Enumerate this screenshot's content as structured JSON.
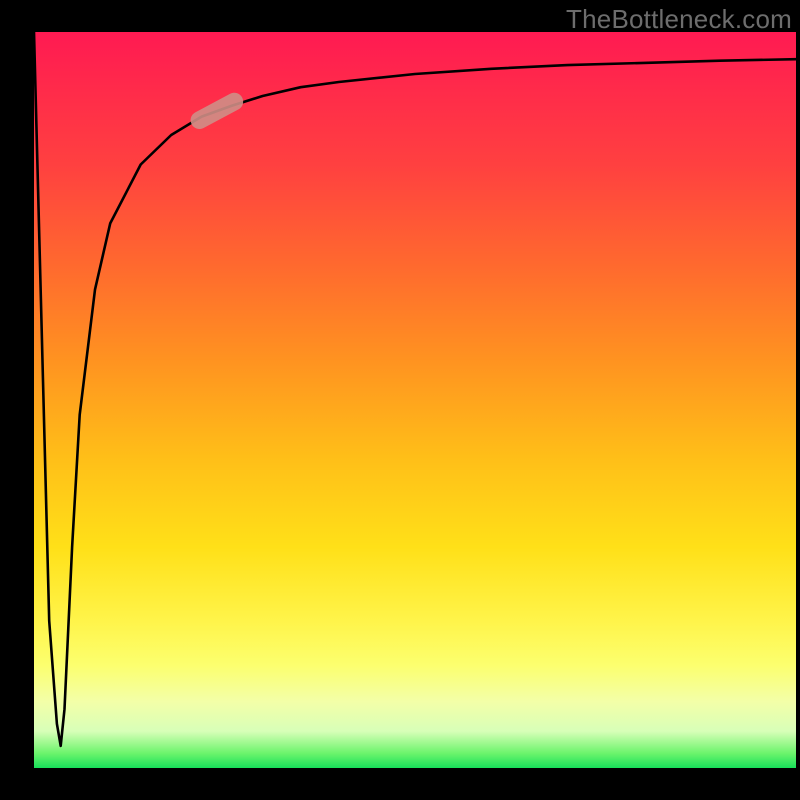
{
  "watermark": "TheBottleneck.com",
  "colors": {
    "marker_fill": "#cf8e86",
    "curve_stroke": "#000000",
    "axis_stroke": "#000000",
    "gradient_top": "#ff1a52",
    "gradient_bottom": "#18e05a"
  },
  "chart_data": {
    "type": "line",
    "title": "",
    "xlabel": "",
    "ylabel": "",
    "xlim": [
      0,
      100
    ],
    "ylim": [
      0,
      100
    ],
    "grid": false,
    "legend": false,
    "series": [
      {
        "name": "bottleneck-curve",
        "x": [
          0,
          1,
          2,
          3,
          3.5,
          4,
          5,
          6,
          8,
          10,
          14,
          18,
          22,
          26,
          30,
          35,
          40,
          50,
          60,
          70,
          80,
          90,
          100
        ],
        "values": [
          100,
          60,
          20,
          6,
          3,
          8,
          30,
          48,
          65,
          74,
          82,
          86,
          88.5,
          90,
          91.3,
          92.5,
          93.2,
          94.3,
          95,
          95.5,
          95.8,
          96.1,
          96.3
        ]
      }
    ],
    "marker": {
      "series": "bottleneck-curve",
      "x_center": 24,
      "y_center": 89.3,
      "angle_deg": -28,
      "length_frac_x": 7.5,
      "thickness_frac_y": 2.4,
      "color": "#cf8e86"
    },
    "note": "Axis tick labels are not shown in the image; x and y are normalized 0–100 against the visible plot area. Values are read off the rendered curve geometry."
  }
}
